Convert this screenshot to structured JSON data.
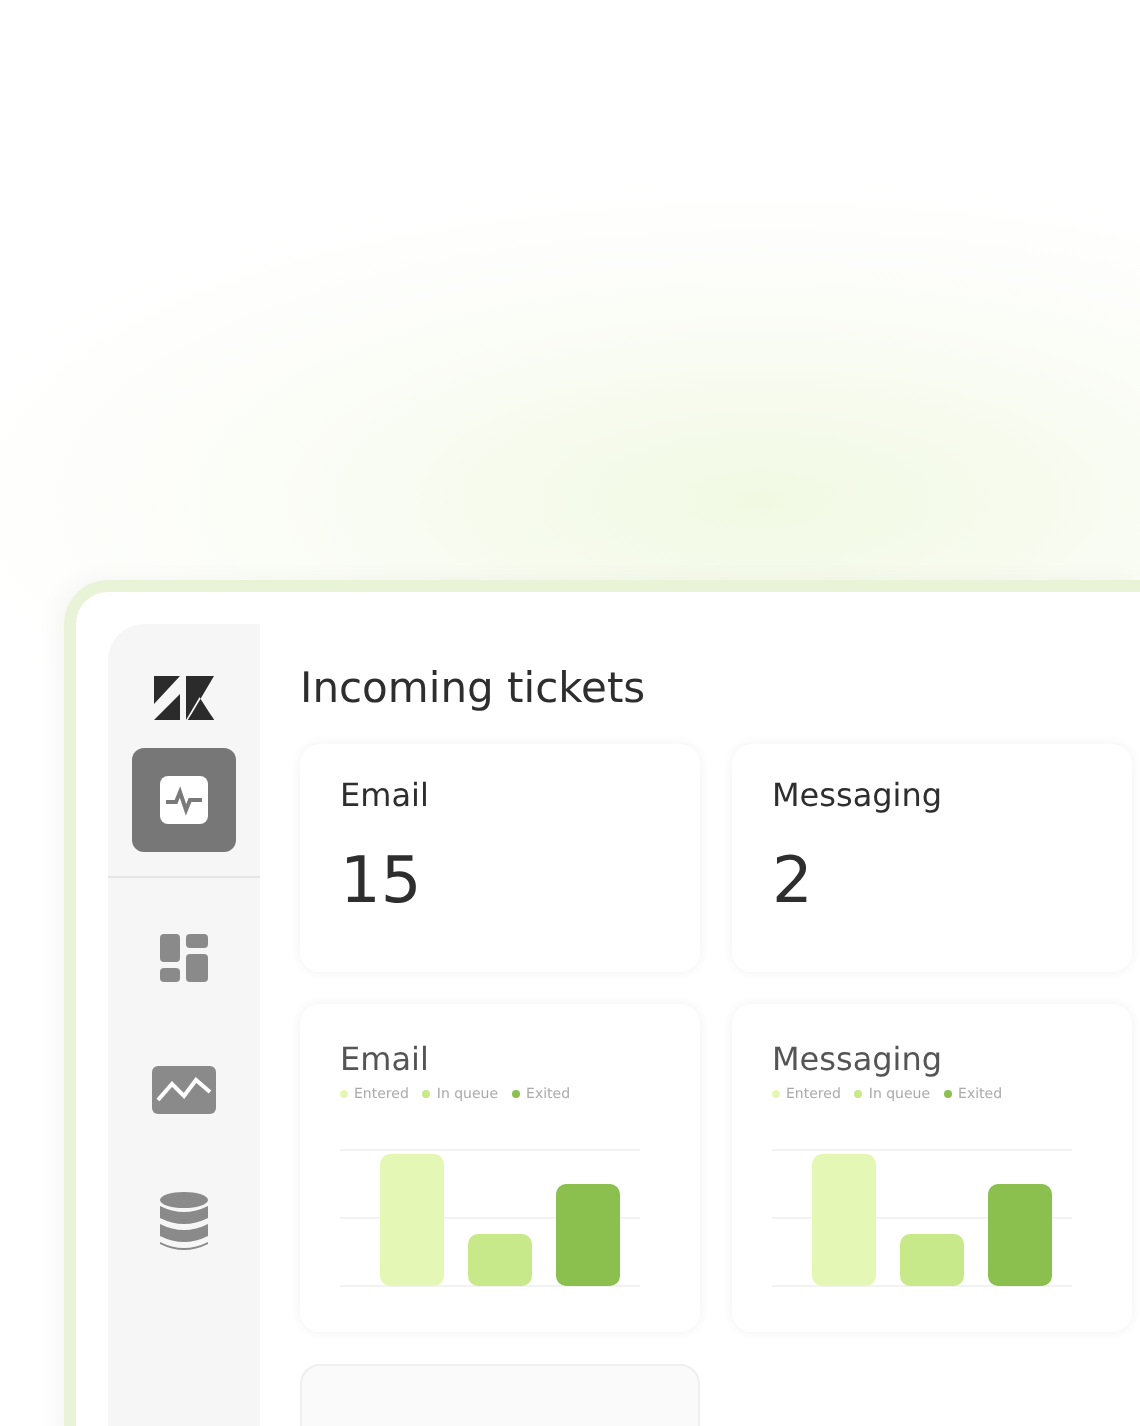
{
  "sidebar": {
    "items": [
      {
        "kind": "pulse",
        "selected": true
      },
      {
        "kind": "dashboard",
        "selected": false
      },
      {
        "kind": "chart",
        "selected": false
      },
      {
        "kind": "database",
        "selected": false
      }
    ]
  },
  "title": "Incoming tickets",
  "stat_cards": [
    {
      "label": "Email",
      "value": "15"
    },
    {
      "label": "Messaging",
      "value": "2"
    }
  ],
  "chart_cards": [
    {
      "title": "Email",
      "legend": [
        {
          "label": "Entered",
          "color": "#e4f7b5"
        },
        {
          "label": "In queue",
          "color": "#c8e98a"
        },
        {
          "label": "Exited",
          "color": "#8cc04e"
        }
      ]
    },
    {
      "title": "Messaging",
      "legend": [
        {
          "label": "Entered",
          "color": "#e4f7b5"
        },
        {
          "label": "In queue",
          "color": "#c8e98a"
        },
        {
          "label": "Exited",
          "color": "#8cc04e"
        }
      ]
    }
  ]
}
